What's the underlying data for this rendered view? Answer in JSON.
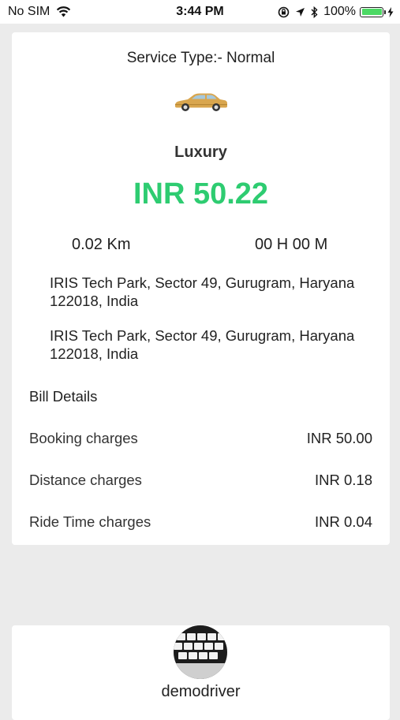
{
  "status_bar": {
    "carrier": "No SIM",
    "time": "3:44 PM",
    "battery": "100%"
  },
  "trip": {
    "service_type": "Service Type:- Normal",
    "vehicle_icon": "car-icon",
    "vehicle_name": "Luxury",
    "fare": "INR 50.22",
    "distance": "0.02 Km",
    "duration": "00 H 00 M",
    "pickup_address": "IRIS Tech Park, Sector 49, Gurugram, Haryana 122018, India",
    "drop_address": "IRIS Tech Park, Sector 49, Gurugram, Haryana 122018, India"
  },
  "bill": {
    "title": "Bill Details",
    "rows": [
      {
        "label": "Booking charges",
        "value": "INR 50.00"
      },
      {
        "label": "Distance charges",
        "value": "INR 0.18"
      },
      {
        "label": "Ride Time charges",
        "value": "INR 0.04"
      }
    ]
  },
  "driver": {
    "name": "demodriver"
  },
  "colors": {
    "fare_green": "#2ecc71",
    "background": "#ebebeb",
    "battery_green": "#4cd964"
  }
}
